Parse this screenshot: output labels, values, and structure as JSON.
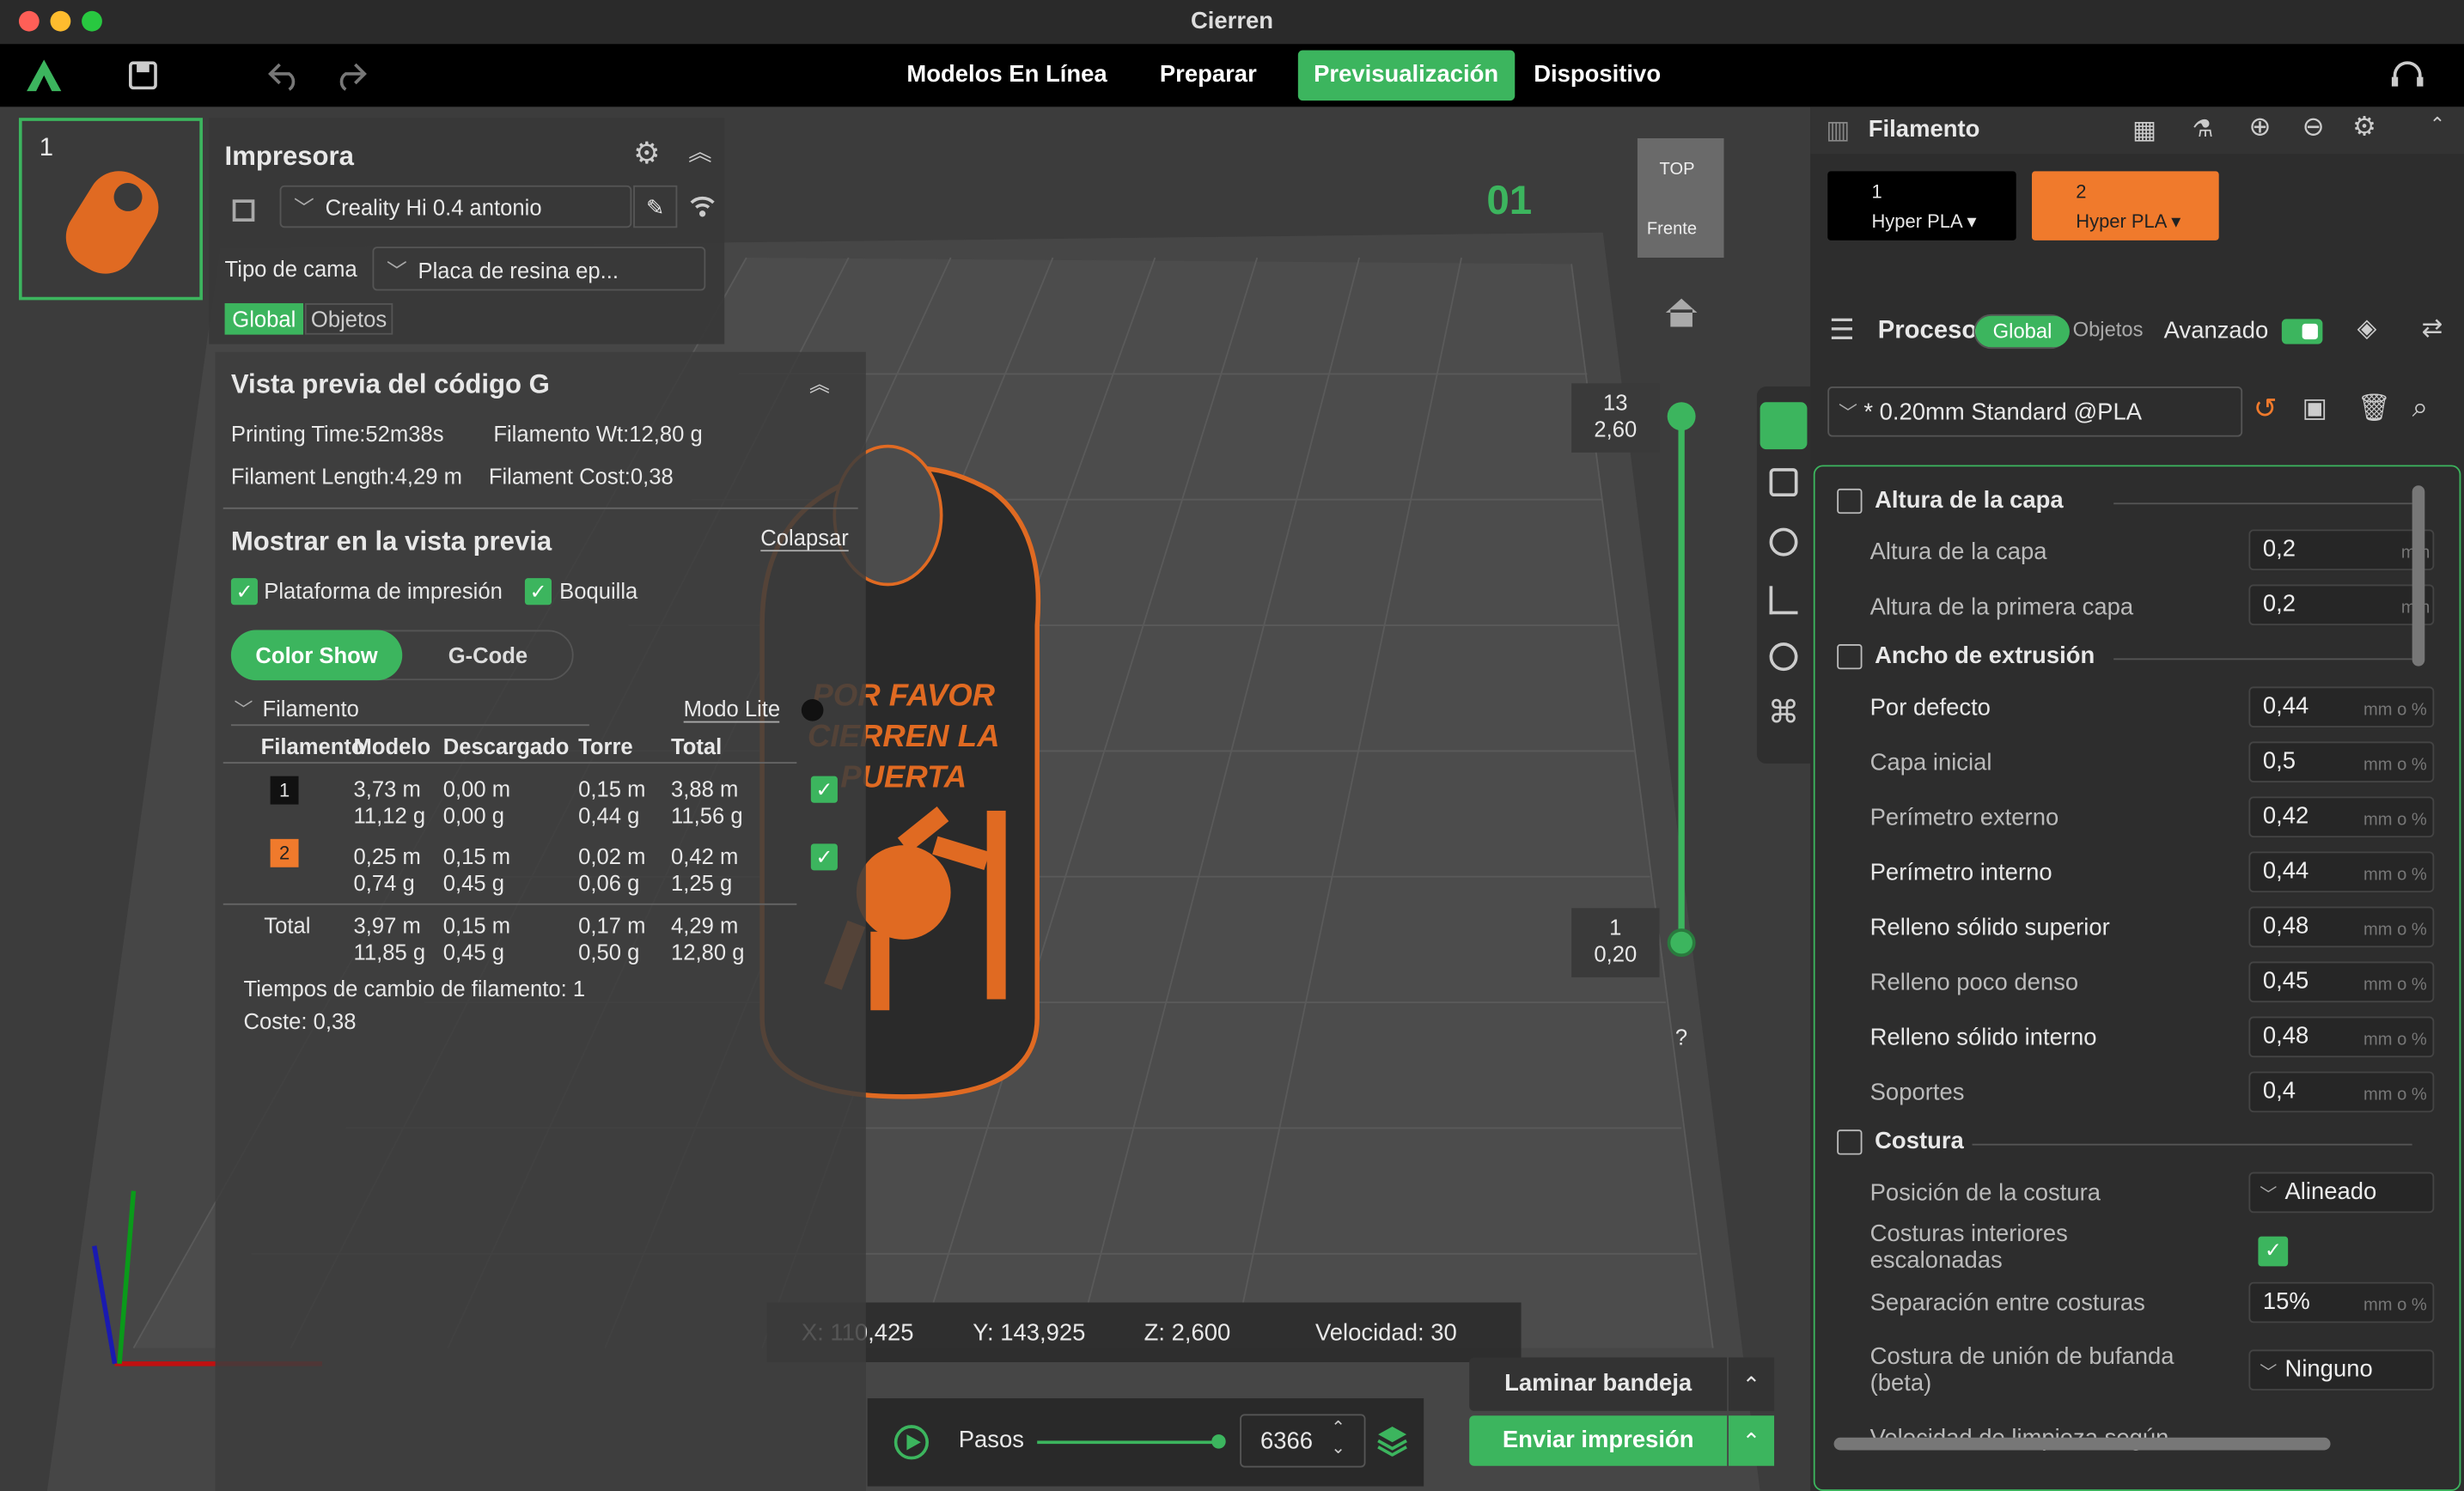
{
  "window": {
    "title": "Cierren"
  },
  "menu": {
    "tabs": [
      "Modelos En Línea",
      "Preparar",
      "Previsualización",
      "Dispositivo"
    ],
    "active": "Previsualización"
  },
  "plate": {
    "number": "1",
    "label": "01"
  },
  "printer": {
    "title": "Impresora",
    "name": "Creality Hi 0.4 antonio",
    "bed_label": "Tipo de cama",
    "bed_value": "Placa de resina ep...",
    "tabs": [
      "Global",
      "Objetos"
    ]
  },
  "gcode": {
    "title": "Vista previa del código G",
    "printing_time": "Printing Time:52m38s",
    "filament_wt": "Filamento Wt:12,80 g",
    "filament_length": "Filament Length:4,29 m",
    "filament_cost": "Filament Cost:0,38",
    "show_title": "Mostrar en la vista previa",
    "collapse": "Colapsar",
    "show_plate": "Plataforma de impresión",
    "show_nozzle": "Boquilla",
    "view_tabs": [
      "Color Show",
      "G-Code"
    ],
    "filter_label": "Filamento",
    "lite_mode": "Modo Lite",
    "headers": [
      "Filamento",
      "Modelo",
      "Descargado",
      "Torre",
      "Total"
    ],
    "rows": [
      {
        "id": "1",
        "modelo": [
          "3,73 m",
          "11,12 g"
        ],
        "descargado": [
          "0,00 m",
          "0,00 g"
        ],
        "torre": [
          "0,15 m",
          "0,44 g"
        ],
        "total": [
          "3,88 m",
          "11,56 g"
        ]
      },
      {
        "id": "2",
        "modelo": [
          "0,25 m",
          "0,74 g"
        ],
        "descargado": [
          "0,15 m",
          "0,45 g"
        ],
        "torre": [
          "0,02 m",
          "0,06 g"
        ],
        "total": [
          "0,42 m",
          "1,25 g"
        ]
      }
    ],
    "total_row": {
      "label": "Total",
      "modelo": [
        "3,97 m",
        "11,85 g"
      ],
      "descargado": [
        "0,15 m",
        "0,45 g"
      ],
      "torre": [
        "0,17 m",
        "0,50 g"
      ],
      "total": [
        "4,29 m",
        "12,80 g"
      ]
    },
    "change_times": "Tiempos de cambio de filamento:  1",
    "cost": "Coste:  0,38"
  },
  "model_text": "POR FAVOR CIERREN LA PUERTA",
  "view_cube": {
    "top": "TOP",
    "front": "Frente"
  },
  "layer_slider": {
    "top_layer": "13",
    "top_height": "2,60",
    "bottom_layer": "1",
    "bottom_height": "0,20",
    "help": "?"
  },
  "coords": {
    "x": "X: 110,425",
    "y": "Y: 143,925",
    "z": "Z: 2,600",
    "speed": "Velocidad: 30"
  },
  "steps": {
    "label": "Pasos",
    "value": "6366"
  },
  "actions": {
    "slice": "Laminar bandeja",
    "send": "Enviar impresión"
  },
  "filament_panel": {
    "title": "Filamento",
    "slots": [
      {
        "id": "1",
        "name": "Hyper PLA",
        "color": "#000000"
      },
      {
        "id": "2",
        "name": "Hyper PLA",
        "color": "#f07a2c"
      }
    ]
  },
  "process": {
    "title": "Proceso",
    "tabs": [
      "Global",
      "Objetos"
    ],
    "advanced": "Avanzado",
    "preset": "* 0.20mm Standard @PLA"
  },
  "settings": {
    "sec_layer": "Altura de la capa",
    "layer_height_label": "Altura de la capa",
    "layer_height": "0,2",
    "first_layer_label": "Altura de la primera capa",
    "first_layer": "0,2",
    "unit_mm": "mm",
    "sec_width": "Ancho de extrusión",
    "unit_pct": "mm o %",
    "w_default_label": "Por defecto",
    "w_default": "0,44",
    "w_initial_label": "Capa inicial",
    "w_initial": "0,5",
    "w_outer_label": "Perímetro externo",
    "w_outer": "0,42",
    "w_inner_label": "Perímetro interno",
    "w_inner": "0,44",
    "w_top_label": "Relleno sólido superior",
    "w_top": "0,48",
    "w_sparse_label": "Relleno poco denso",
    "w_sparse": "0,45",
    "w_solid_label": "Relleno sólido interno",
    "w_solid": "0,48",
    "w_support_label": "Soportes",
    "w_support": "0,4",
    "sec_seam": "Costura",
    "seam_pos_label": "Posición de la costura",
    "seam_pos": "Alineado",
    "stagger_label_1": "Costuras interiores",
    "stagger_label_2": "escalonadas",
    "seam_gap_label": "Separación entre costuras",
    "seam_gap": "15%",
    "scarf_label_1": "Costura de unión de bufanda",
    "scarf_label_2": "(beta)",
    "scarf": "Ninguno",
    "wipe_label": "Velocidad de limpieza según"
  },
  "colors": {
    "accent": "#3cb55e",
    "orange": "#f07a2c"
  }
}
